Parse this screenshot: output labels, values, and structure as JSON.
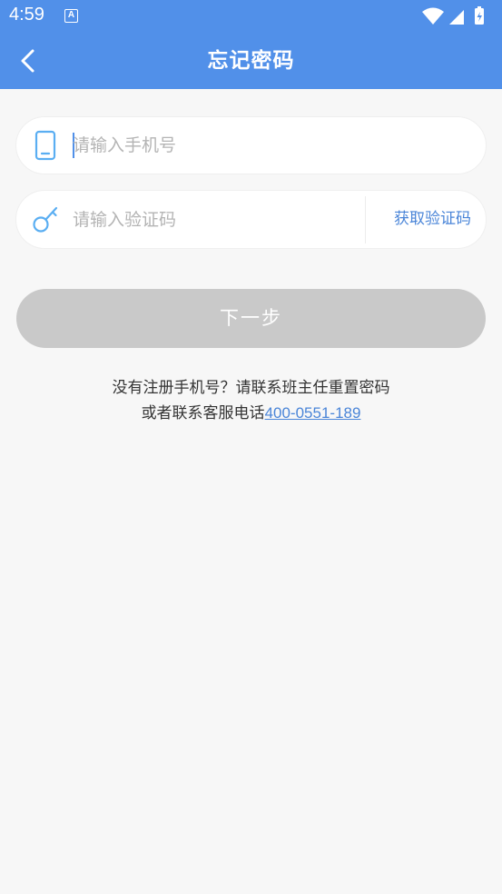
{
  "status_bar": {
    "time": "4:59",
    "notification_letter": "A"
  },
  "header": {
    "title": "忘记密码"
  },
  "form": {
    "phone_placeholder": "请输入手机号",
    "code_placeholder": "请输入验证码",
    "get_code_label": "获取验证码",
    "next_label": "下一步"
  },
  "hint": {
    "line1": "没有注册手机号？请联系班主任重置密码",
    "line2_prefix": "或者联系客服电话",
    "phone_number": "400-0551-189"
  },
  "colors": {
    "primary": "#5190e9",
    "link": "#4a85d8",
    "disabled_button": "#c9c9c9",
    "background": "#f7f7f7"
  }
}
